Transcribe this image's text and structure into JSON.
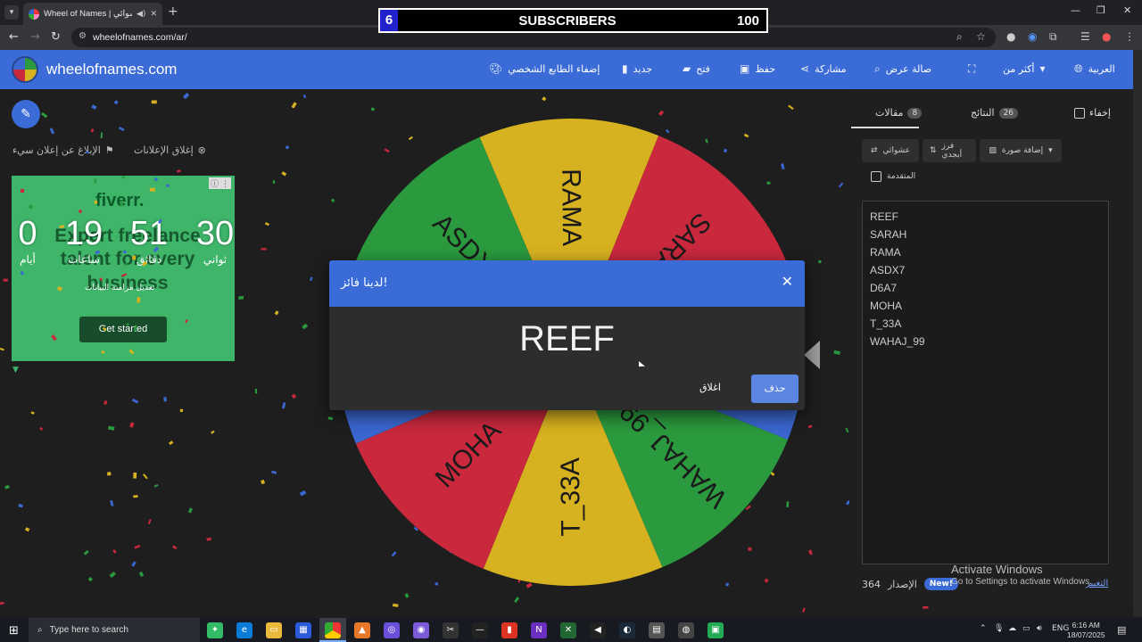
{
  "browser": {
    "tab_title": "Wheel of Names | العشوائي",
    "url": "wheelofnames.com/ar/"
  },
  "stream_overlay": {
    "count": "6",
    "label": "SUBSCRIBERS",
    "goal": "100"
  },
  "site": {
    "name": "wheelofnames.com",
    "menu": [
      {
        "label": "إضفاء الطابع الشخصي",
        "icon": "palette-icon"
      },
      {
        "label": "جديد",
        "icon": "new-file-icon"
      },
      {
        "label": "فتح",
        "icon": "folder-icon"
      },
      {
        "label": "حفظ",
        "icon": "save-icon"
      },
      {
        "label": "مشاركة",
        "icon": "share-icon"
      },
      {
        "label": "صالة عرض",
        "icon": "search-icon"
      },
      {
        "label": "",
        "icon": "fullscreen-icon"
      },
      {
        "label": "أكثر من",
        "icon": "chevron-down-icon"
      },
      {
        "label": "العربية",
        "icon": "globe-icon"
      }
    ]
  },
  "ads": {
    "close_ads": "إغلاق الإعلانات",
    "report_ad": "الإبلاغ عن إعلان سيء",
    "brand": "fiverr.",
    "tagline": "Expert freelance talent for every business",
    "cta": "Get started",
    "notice": "تعديل مزامنة البيانات"
  },
  "countdown": [
    {
      "value": "0",
      "unit": "أيام"
    },
    {
      "value": "19",
      "unit": "ساعات"
    },
    {
      "value": "51",
      "unit": "دقائق"
    },
    {
      "value": "30",
      "unit": "ثواني"
    }
  ],
  "wheel": {
    "colors": {
      "green": "#2b9a3e",
      "yellow": "#d7b220",
      "red": "#c9283d",
      "blue": "#3a67d0"
    },
    "slices": [
      "REEF",
      "SARAH",
      "RAMA",
      "ASDX7",
      "D6A7",
      "MOHA",
      "T_33A",
      "WAHAJ_99"
    ]
  },
  "dialog": {
    "title": "لدينا فائز!",
    "winner": "REEF",
    "remove": "حذف",
    "close": "اغلاق"
  },
  "panel": {
    "tabs": [
      {
        "label": "مقالات",
        "count": "8"
      },
      {
        "label": "النتائج",
        "count": "26"
      }
    ],
    "hide": "إخفاء",
    "shuffle": "عشوائي",
    "sort": "فرز أبجدي",
    "add_image": "إضافة صورة",
    "advanced": "المتقدمة",
    "entries": [
      "REEF",
      "SARAH",
      "RAMA",
      "ASDX7",
      "D6A7",
      "MOHA",
      "T_33A",
      "WAHAJ_99"
    ],
    "new_badge": "New!",
    "version_label": "الإصدار",
    "version": "364",
    "changelog": "التغيير"
  },
  "windows": {
    "activate_title": "Activate Windows",
    "activate_sub": "Go to Settings to activate Windows.",
    "search_placeholder": "Type here to search",
    "lang": "ENG",
    "time": "6:16 AM",
    "date": "18/07/2025"
  }
}
